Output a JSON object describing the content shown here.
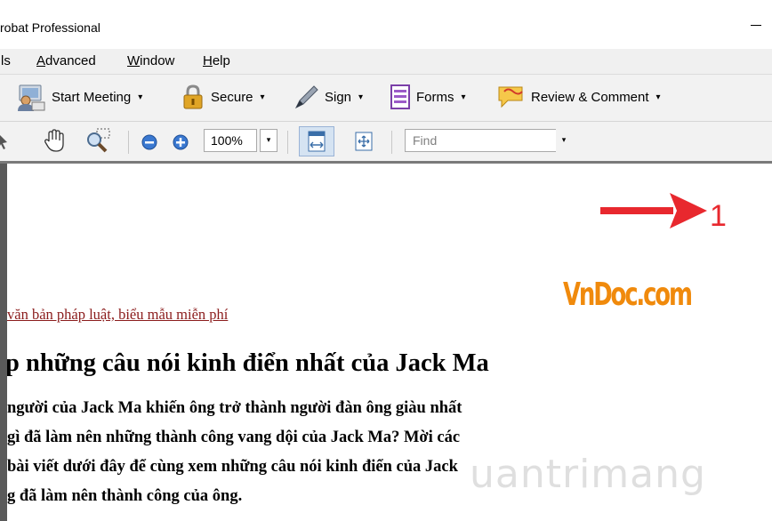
{
  "window": {
    "title": "robat Professional"
  },
  "menu": {
    "items": [
      {
        "label": "ls",
        "underline": ""
      },
      {
        "label": "Advanced",
        "underline": "A"
      },
      {
        "label": "Window",
        "underline": "W"
      },
      {
        "label": "Help",
        "underline": "H"
      }
    ]
  },
  "toolbar": {
    "start_meeting": "Start Meeting",
    "secure": "Secure",
    "sign": "Sign",
    "forms": "Forms",
    "review": "Review & Comment",
    "dropdown_caret": "▾"
  },
  "nav": {
    "zoom_value": "100%",
    "find_placeholder": "Find"
  },
  "document": {
    "annotation_number": "1",
    "logo_text": "VnDoc.com",
    "link_text": "văn bản pháp luật, biểu mẫu miễn phí",
    "heading": "p những câu nói kinh điển nhất của Jack Ma",
    "paragraph": [
      "người của Jack Ma khiến ông trở thành người đàn ông giàu nhất",
      "gì đã làm nên những thành công vang dội của Jack Ma? Mời các",
      "bài viết dưới đây để cùng xem những câu nói kinh điển của Jack",
      "g đã làm nên thành công của ông."
    ],
    "watermark": "uantrimang"
  },
  "colors": {
    "accent_red": "#e8282e",
    "logo_orange": "#f08a0c",
    "link_red": "#8b1c1c"
  }
}
